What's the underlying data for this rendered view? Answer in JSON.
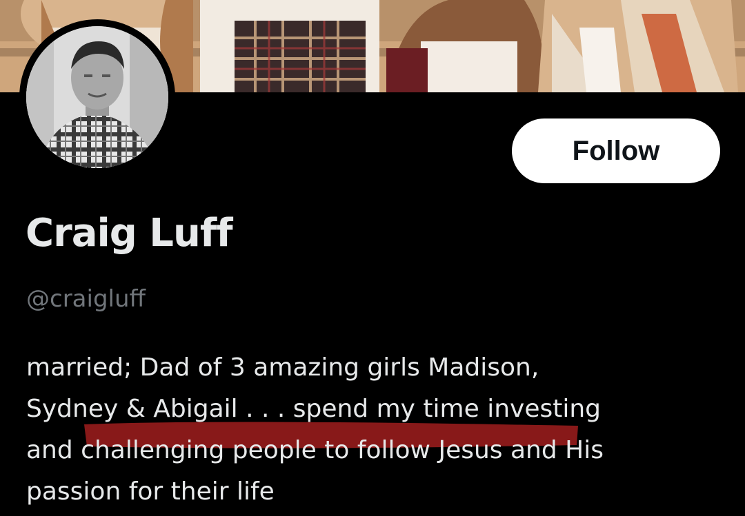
{
  "profile": {
    "display_name": "Craig Luff",
    "handle": "@craigluff",
    "bio_lines": [
      "married; Dad of 3 amazing girls Madison,",
      "Sydney & Abigail . . . spend my time investing",
      "and challenging people to follow Jesus and His",
      "passion for their life"
    ]
  },
  "actions": {
    "follow_label": "Follow"
  },
  "colors": {
    "background": "#000000",
    "name_text": "#e7e9ea",
    "handle_text": "#71767b",
    "button_bg": "#ffffff",
    "button_text": "#0f1419",
    "highlight_marker": "#9b1c1c"
  }
}
